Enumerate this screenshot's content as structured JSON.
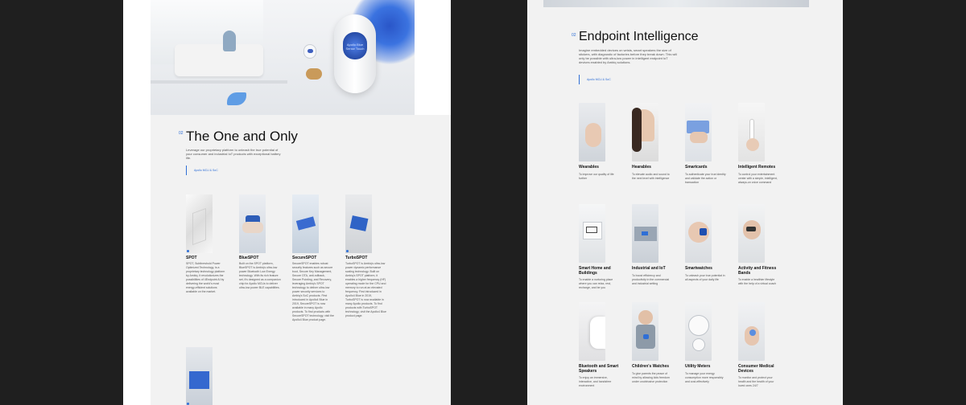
{
  "colors": {
    "background": "#1f1f1f",
    "accent": "#2f6fd6",
    "panel_left": "#ffffff",
    "panel_right": "#f2f2f2"
  },
  "hero": {
    "speaker_screen_text": "Apollo Blue Sense Touch"
  },
  "left": {
    "section_number": "02",
    "title": "The One and Only",
    "description": "Leverage our proprietary platform to unleash the true potential of your consumer and industrial IoT products with exceptional battery life.",
    "cta": "Apollo MCU & SoC",
    "products": [
      {
        "name": "SPOT",
        "description": "SPOT, Subthreshold Power Optimized Technology, is a proprietary technology platform by Ambiq. It revolutionizes the possibilities of 4Endpoint AI by delivering the world's most energy-efficient solutions available on the market."
      },
      {
        "name": "BlueSPOT",
        "description": "Built on the SPOT platform, BlueSPOT is Ambiq's ultra-low power Bluetooth Low Energy technology. With its rich feature set, it's designed as a companion chip for Apollo MCUs to deliver ultra-low power BLE capabilities."
      },
      {
        "name": "SecureSPOT",
        "description": "SecureSPOT enables robust security features such as secure boot, Secure Key Management, Secure OTA, anti-rollback, Secure Pointing, and Recovery, leveraging Ambiq's SPOT technology to deliver ultra-low power security services to Ambiq's SoC products. First introduced in Apollo4 Blue in 2019, SecureSPOT is now available in many Apollo products. To find products with SecureSPOT technology, visit the Apollo4 Blue product page."
      },
      {
        "name": "TurboSPOT",
        "description": "TurboSPOT is Ambiq's ultra-low power dynamic performance scaling technology. Built on Ambiq's SPOT platform, it enables a higher frequency (HF) operating mode for the CPU and memory to run at an elevated frequency. First introduced in Apollo4 Blue in 2019, TurboSPOT is now available in many Apollo products. To find products with TurboSPOT technology, visit the Apollo4 Blue product page."
      }
    ]
  },
  "right": {
    "section_number": "02",
    "title": "Endpoint Intelligence",
    "description": "Imagine embedded devices on wrists, smart speakers the size of stickers, with diagnostic of factories before they break down. This will only be possible with ultra-low power in intelligent endpoint IoT devices enabled by Ambiq solutions.",
    "cta": "Apollo MCU & SoC",
    "devices": [
      {
        "name": "Wearables",
        "description": "To improve our quality of life further"
      },
      {
        "name": "Hearables",
        "description": "To elevate audio and sound to the next level with intelligence"
      },
      {
        "name": "Smartcards",
        "description": "To authenticate your true identity and validate the action or transaction"
      },
      {
        "name": "Intelligent Remotes",
        "description": "To control your entertainment center with a simple, intelligent, always-on voice command"
      },
      {
        "name": "Smart Home and Buildings",
        "description": "To enable a nurturing place where you can relax, rest, recharge, and be you"
      },
      {
        "name": "Industrial and IoT",
        "description": "To boost efficiency and productivity in the commercial and industrial setting"
      },
      {
        "name": "Smartwatches",
        "description": "To unleash your true potential in all aspects of your daily life"
      },
      {
        "name": "Activity and Fitness Bands",
        "description": "To enable a healthier lifestyle with the help of a virtual coach"
      },
      {
        "name": "Bluetooth and Smart Speakers",
        "description": "To enjoy an immersive, interactive, and handsfree environment"
      },
      {
        "name": "Children's Watches",
        "description": "To give parents the peace of mind by allowing kids freedom under unobtrusive protection"
      },
      {
        "name": "Utility Meters",
        "description": "To manage your energy consumption more responsibly and cost-effectively"
      },
      {
        "name": "Consumer Medical Devices",
        "description": "To monitor and protect your health and the health of your loved ones 24/7"
      }
    ]
  }
}
